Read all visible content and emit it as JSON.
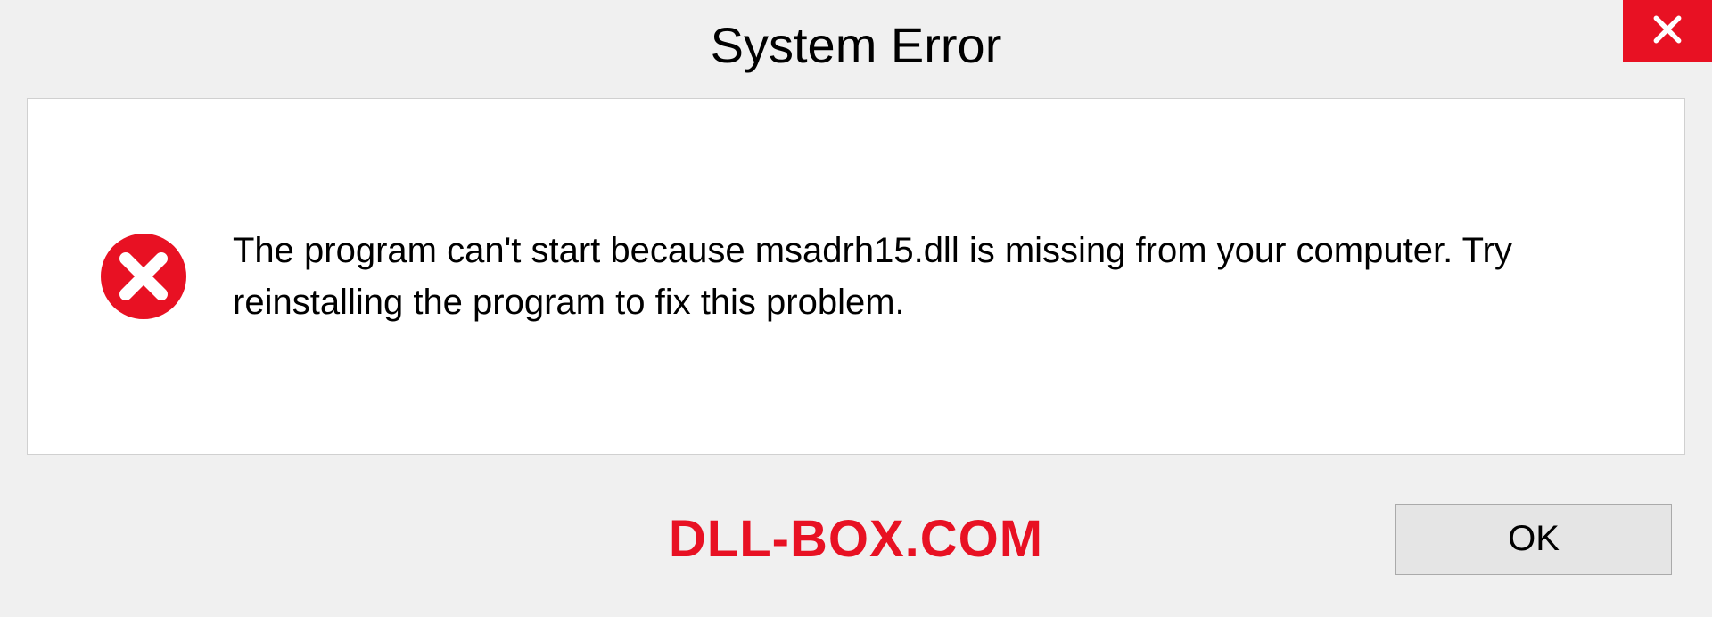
{
  "dialog": {
    "title": "System Error",
    "message": "The program can't start because msadrh15.dll is missing from your computer. Try reinstalling the program to fix this problem.",
    "ok_label": "OK"
  },
  "watermark": "DLL-BOX.COM"
}
